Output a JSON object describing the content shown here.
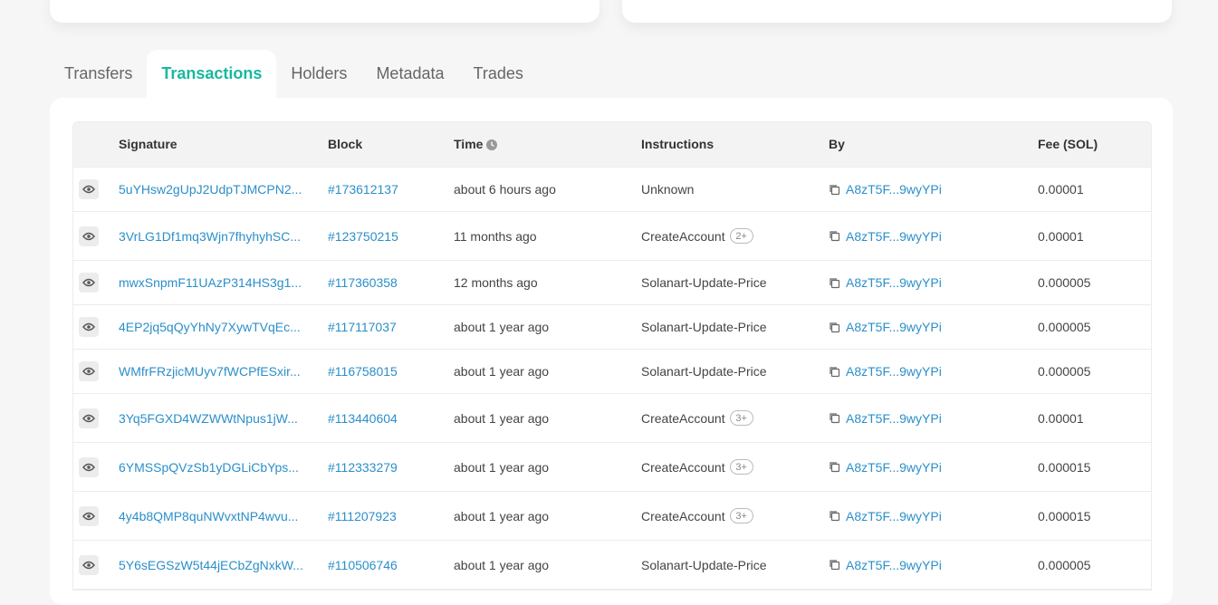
{
  "tabs": [
    {
      "label": "Transfers",
      "active": false
    },
    {
      "label": "Transactions",
      "active": true
    },
    {
      "label": "Holders",
      "active": false
    },
    {
      "label": "Metadata",
      "active": false
    },
    {
      "label": "Trades",
      "active": false
    }
  ],
  "table": {
    "headers": {
      "signature": "Signature",
      "block": "Block",
      "time": "Time",
      "instructions": "Instructions",
      "by": "By",
      "fee": "Fee (SOL)"
    },
    "rows": [
      {
        "signature": "5uYHsw2gUpJ2UdpTJMCPN2...",
        "block": "#173612137",
        "time": "about 6 hours ago",
        "instruction": "Unknown",
        "badge": "",
        "by": "A8zT5F...9wyYPi",
        "fee": "0.00001"
      },
      {
        "signature": "3VrLG1Df1mq3Wjn7fhyhyhSC...",
        "block": "#123750215",
        "time": "11 months ago",
        "instruction": "CreateAccount",
        "badge": "2+",
        "by": "A8zT5F...9wyYPi",
        "fee": "0.00001"
      },
      {
        "signature": "mwxSnpmF11UAzP314HS3g1...",
        "block": "#117360358",
        "time": "12 months ago",
        "instruction": "Solanart-Update-Price",
        "badge": "",
        "by": "A8zT5F...9wyYPi",
        "fee": "0.000005"
      },
      {
        "signature": "4EP2jq5qQyYhNy7XywTVqEc...",
        "block": "#117117037",
        "time": "about 1 year ago",
        "instruction": "Solanart-Update-Price",
        "badge": "",
        "by": "A8zT5F...9wyYPi",
        "fee": "0.000005"
      },
      {
        "signature": "WMfrFRzjicMUyv7fWCPfESxir...",
        "block": "#116758015",
        "time": "about 1 year ago",
        "instruction": "Solanart-Update-Price",
        "badge": "",
        "by": "A8zT5F...9wyYPi",
        "fee": "0.000005"
      },
      {
        "signature": "3Yq5FGXD4WZWWtNpus1jW...",
        "block": "#113440604",
        "time": "about 1 year ago",
        "instruction": "CreateAccount",
        "badge": "3+",
        "by": "A8zT5F...9wyYPi",
        "fee": "0.00001"
      },
      {
        "signature": "6YMSSpQVzSb1yDGLiCbYps...",
        "block": "#112333279",
        "time": "about 1 year ago",
        "instruction": "CreateAccount",
        "badge": "3+",
        "by": "A8zT5F...9wyYPi",
        "fee": "0.000015"
      },
      {
        "signature": "4y4b8QMP8quNWvxtNP4wvu...",
        "block": "#111207923",
        "time": "about 1 year ago",
        "instruction": "CreateAccount",
        "badge": "3+",
        "by": "A8zT5F...9wyYPi",
        "fee": "0.000015"
      },
      {
        "signature": "5Y6sEGSzW5t44jECbZgNxkW...",
        "block": "#110506746",
        "time": "about 1 year ago",
        "instruction": "Solanart-Update-Price",
        "badge": "",
        "by": "A8zT5F...9wyYPi",
        "fee": "0.000005"
      }
    ]
  },
  "colors": {
    "accent": "#19b8a0",
    "link": "#2b8fc9"
  }
}
